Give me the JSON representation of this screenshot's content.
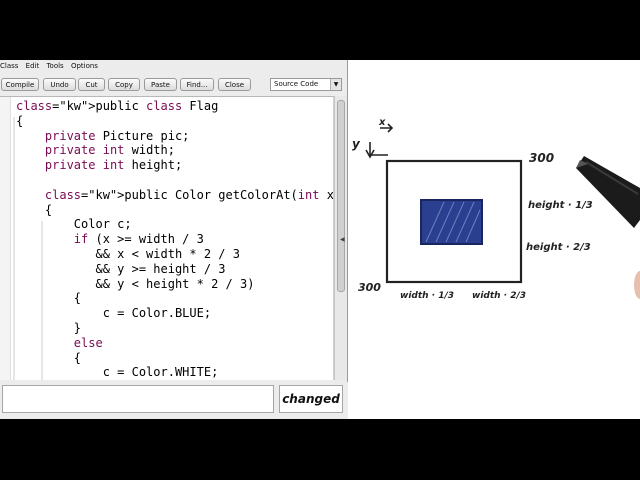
{
  "menu": [
    "Class",
    "Edit",
    "Tools",
    "Options"
  ],
  "toolbar": {
    "compile": "Compile",
    "undo": "Undo",
    "cut": "Cut",
    "copy": "Copy",
    "paste": "Paste",
    "find": "Find...",
    "close": "Close",
    "view_select": "Source Code"
  },
  "code_lines": [
    "public class Flag",
    "{",
    "    private Picture pic;",
    "    private int width;",
    "    private int height;",
    "",
    "    public Color getColorAt(int x, int y)",
    "    {",
    "        Color c;",
    "        if (x >= width / 3",
    "           && x < width * 2 / 3",
    "           && y >= height / 3",
    "           && y < height * 2 / 3)",
    "        {",
    "            c = Color.BLUE;",
    "        }",
    "        else",
    "        {",
    "            c = Color.WHITE;"
  ],
  "status": "changed",
  "message": "",
  "sketch": {
    "x_label": "x",
    "y_label": "y",
    "right_top": "300",
    "left_bottom": "300",
    "height_third": "height · 1/3",
    "height_two_thirds": "height · 2/3",
    "width_third": "width · 1/3",
    "width_two_thirds": "width · 2/3",
    "ink_color": "#222222",
    "fill_color": "#2a3f8f"
  }
}
